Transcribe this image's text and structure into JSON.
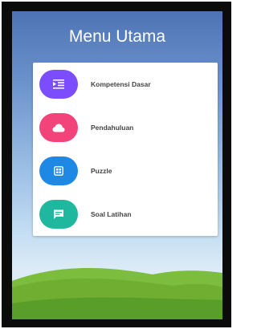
{
  "header": {
    "title": "Menu Utama"
  },
  "menu": {
    "items": [
      {
        "label": "Kompetensi Dasar",
        "icon": "list-icon",
        "color": "#7c4dff"
      },
      {
        "label": "Pendahuluan",
        "icon": "cloud-icon",
        "color": "#f2447b"
      },
      {
        "label": "Puzzle",
        "icon": "grid-icon",
        "color": "#1e88e5"
      },
      {
        "label": "Soal Latihan",
        "icon": "chat-icon",
        "color": "#1fb79d"
      }
    ]
  },
  "colors": {
    "sky_top": "#4d73b4",
    "sky_bottom": "#dcebf6",
    "grass_light": "#8cc84b",
    "grass_dark": "#5a9e2a"
  }
}
